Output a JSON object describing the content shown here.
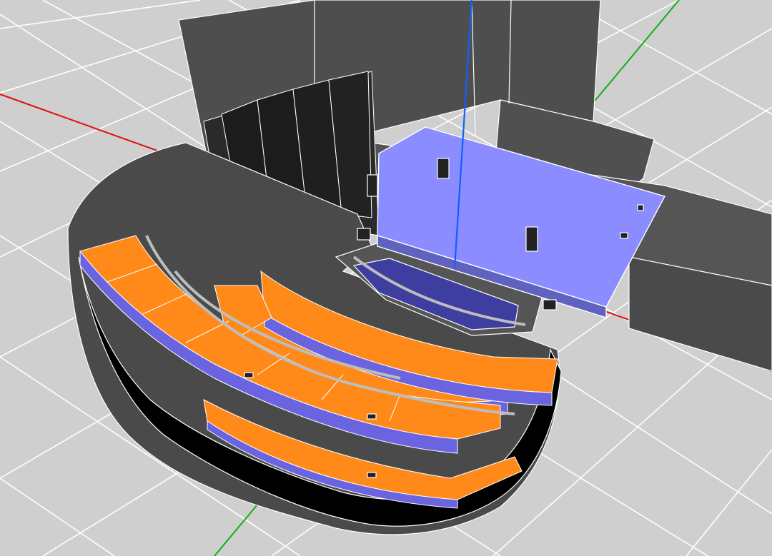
{
  "viewport": {
    "view_mode": "3d-perspective",
    "render_style": "shaded-with-wireframe",
    "ground_grid": "visible",
    "colors": {
      "grid_background": "#cfcfcf",
      "grid_lines": "#ffffff",
      "wall": "#4a4a4a",
      "wall_dark": "#1c1c1c",
      "stage_platform": "#8a8cff",
      "audience_area": "#ff8a1a",
      "seating_riser": "#6a64e0",
      "pit_floor": "#3e3ea0",
      "edges": "#ffffff",
      "axis_x": "#e01010",
      "axis_y": "#10b010",
      "axis_z": "#1060ff"
    },
    "axes": [
      "x-axis",
      "y-axis",
      "z-axis"
    ],
    "objects": [
      "stage-house-wall",
      "stage-reflector-panels",
      "stage-platform",
      "orchestra-pit",
      "balcony-tier-1",
      "balcony-tier-2",
      "balcony-tier-3",
      "auditorium-shell",
      "speaker-clusters"
    ]
  }
}
